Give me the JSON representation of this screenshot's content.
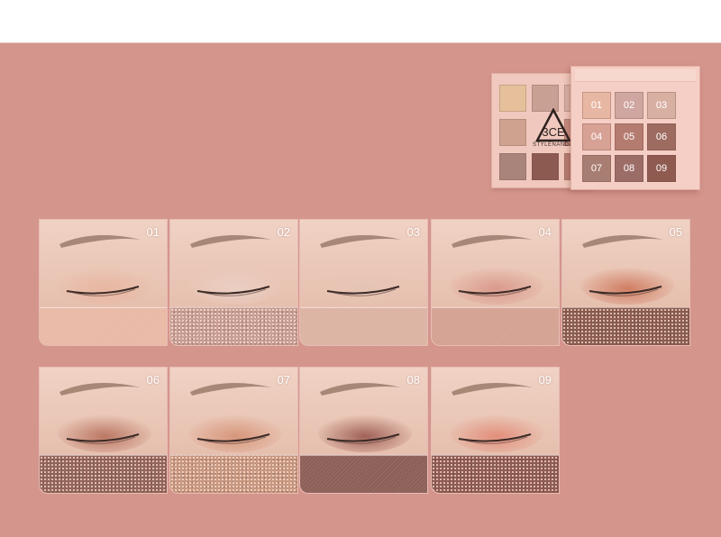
{
  "palette": {
    "logo_text": "3CE",
    "brand": "STYLENANDA",
    "pans_left": [
      "#e6c09b",
      "#c9a194",
      "#d9b1a5",
      "#cfa290",
      "#b98a7e",
      "#c48b7f",
      "#a8847a",
      "#8d5a52",
      "#b57d72"
    ],
    "pans_right": [
      {
        "label": "01",
        "color": "#e8b7a4",
        "dark": false
      },
      {
        "label": "02",
        "color": "#cfa6a0",
        "dark": false
      },
      {
        "label": "03",
        "color": "#d8b0a2",
        "dark": false
      },
      {
        "label": "04",
        "color": "#d7a295",
        "dark": false
      },
      {
        "label": "05",
        "color": "#b47c70",
        "dark": false
      },
      {
        "label": "06",
        "color": "#9e6b60",
        "dark": false
      },
      {
        "label": "07",
        "color": "#a97e72",
        "dark": false
      },
      {
        "label": "08",
        "color": "#9b6d66",
        "dark": false
      },
      {
        "label": "09",
        "color": "#8f5a50",
        "dark": false
      }
    ]
  },
  "swatches": [
    {
      "label": "01",
      "shadow": "#e8b6a0",
      "swatch": "#e9b9a6",
      "glitter": false
    },
    {
      "label": "02",
      "shadow": "#ead0c4",
      "swatch": "#c99e95",
      "glitter": true
    },
    {
      "label": "03",
      "shadow": "#e6c4b4",
      "swatch": "#dcb3a3",
      "glitter": false
    },
    {
      "label": "04",
      "shadow": "#d9978a",
      "swatch": "#d4a292",
      "glitter": false
    },
    {
      "label": "05",
      "shadow": "#cf7a5e",
      "swatch": "#8c5d50",
      "glitter": true
    },
    {
      "label": "06",
      "shadow": "#b8735f",
      "swatch": "#94655a",
      "glitter": true
    },
    {
      "label": "07",
      "shadow": "#d69477",
      "swatch": "#c99880",
      "glitter": true
    },
    {
      "label": "08",
      "shadow": "#9c5c53",
      "swatch": "#8c5f58",
      "glitter": false
    },
    {
      "label": "09",
      "shadow": "#e28c78",
      "swatch": "#8f5b52",
      "glitter": true
    }
  ]
}
